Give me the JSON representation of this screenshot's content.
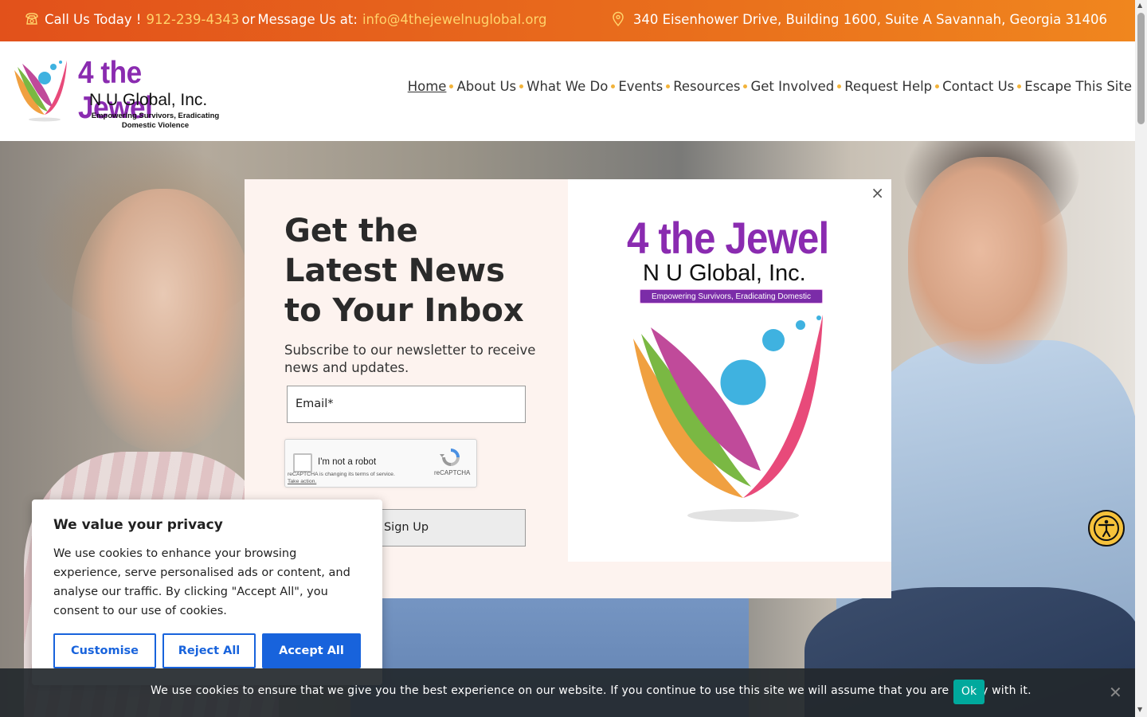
{
  "topbar": {
    "call_label": "Call Us Today !",
    "phone": "912-239-4343",
    "or_label": "or",
    "message_label": "Message Us at:",
    "email": "info@4thejewelnuglobal.org",
    "address": "340 Eisenhower Drive, Building 1600, Suite A Savannah, Georgia 31406"
  },
  "logo": {
    "title": "4 the Jewel",
    "subtitle": "N U Global, Inc.",
    "tagline": "Empowering Survivors, Eradicating Domestic Violence"
  },
  "nav": {
    "items": [
      {
        "label": "Home"
      },
      {
        "label": "About Us"
      },
      {
        "label": "What We Do"
      },
      {
        "label": "Events"
      },
      {
        "label": "Resources"
      },
      {
        "label": "Get Involved"
      },
      {
        "label": "Request Help"
      },
      {
        "label": "Contact Us"
      },
      {
        "label": "Escape This Site"
      }
    ]
  },
  "popup": {
    "close_symbol": "×",
    "title": "Get the Latest News to Your Inbox",
    "subtitle": "Subscribe to our newsletter to receive news and updates.",
    "email_placeholder": "Email*",
    "captcha_label": "I'm not a robot",
    "captcha_notice": "reCAPTCHA is changing its terms of service.",
    "captcha_action": "Take action.",
    "captcha_brand": "reCAPTCHA",
    "signup_label": "Sign Up",
    "logo_title": "4 the Jewel",
    "logo_subtitle": "N U Global, Inc.",
    "logo_tagline": "Empowering Survivors, Eradicating Domestic Violence"
  },
  "consent": {
    "title": "We value your privacy",
    "body": "We use cookies to enhance your browsing experience, serve personalised ads or content, and analyse our traffic. By clicking \"Accept All\", you consent to our use of cookies.",
    "customise_label": "Customise",
    "reject_label": "Reject All",
    "accept_label": "Accept All"
  },
  "bottombar": {
    "text": "We use cookies to ensure that we give you the best experience on our website. If you continue to use this site we will assume that you are happy with it.",
    "ok_label": "Ok",
    "close_symbol": "✕"
  },
  "colors": {
    "topbar_start": "#e2511b",
    "topbar_end": "#f0861e",
    "brand_purple": "#8a2bb0",
    "consent_blue": "#1863dc",
    "ok_teal": "#00a99d"
  },
  "icons": [
    "phone-icon",
    "location-pin-icon",
    "close-icon",
    "recaptcha-icon",
    "accessibility-icon"
  ]
}
